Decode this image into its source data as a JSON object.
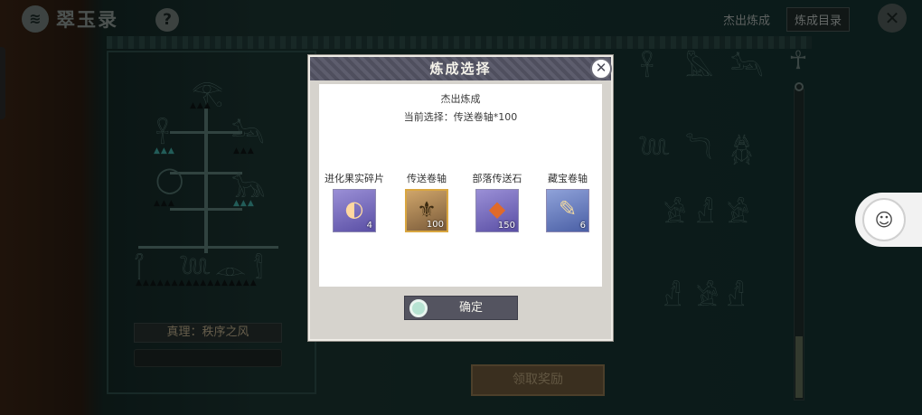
{
  "header": {
    "logo_mark": "≋",
    "app_title": "翠玉录",
    "help_glyph": "?",
    "close_glyph": "✕",
    "tabs": [
      {
        "label": "杰出炼成"
      },
      {
        "label": "炼成目录"
      }
    ]
  },
  "board": {
    "truth_label": "真理：秩序之风",
    "reward_button": "领取奖励"
  },
  "modal": {
    "title": "炼成选择",
    "close_glyph": "✕",
    "subtitle": "杰出炼成",
    "current_selection": "当前选择：传送卷轴*100",
    "items": [
      {
        "name": "进化果实碎片",
        "count": "4",
        "icon": "fruit-shard-icon",
        "glyph": "◐"
      },
      {
        "name": "传送卷轴",
        "count": "100",
        "icon": "teleport-scroll-icon",
        "glyph": "⚜"
      },
      {
        "name": "部落传送石",
        "count": "150",
        "icon": "tribe-teleport-stone-icon",
        "glyph": "◆"
      },
      {
        "name": "藏宝卷轴",
        "count": "6",
        "icon": "treasure-scroll-icon",
        "glyph": "✎"
      }
    ],
    "selected_index": 1,
    "confirm_label": "确定"
  },
  "colors": {
    "modal_header": "#5d5d6d",
    "selected_border": "#d9a640",
    "reward_button": "#6a573a"
  }
}
